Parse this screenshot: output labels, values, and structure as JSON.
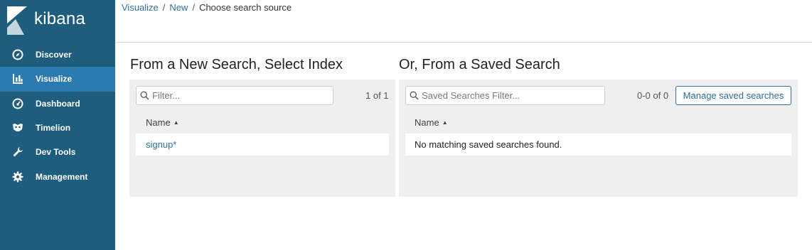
{
  "app": {
    "logo_text": "kibana"
  },
  "sidebar": {
    "items": [
      {
        "label": "Discover",
        "icon": "compass-icon"
      },
      {
        "label": "Visualize",
        "icon": "bar-chart-icon"
      },
      {
        "label": "Dashboard",
        "icon": "dashboard-gauge-icon"
      },
      {
        "label": "Timelion",
        "icon": "timelion-mask-icon"
      },
      {
        "label": "Dev Tools",
        "icon": "wrench-icon"
      },
      {
        "label": "Management",
        "icon": "gear-icon"
      }
    ],
    "active_index": 1
  },
  "breadcrumb": {
    "items": [
      "Visualize",
      "New"
    ],
    "separator": "/",
    "current": "Choose search source"
  },
  "left_panel": {
    "title": "From a New Search, Select Index",
    "filter_placeholder": "Filter...",
    "pager": "1 of 1",
    "column_header": "Name",
    "rows": [
      "signup*"
    ]
  },
  "right_panel": {
    "title": "Or, From a Saved Search",
    "filter_placeholder": "Saved Searches Filter...",
    "pager": "0-0 of 0",
    "manage_button": "Manage saved searches",
    "column_header": "Name",
    "empty_message": "No matching saved searches found."
  },
  "colors": {
    "sidebar_bg": "#1f5d7e",
    "sidebar_active": "#2c7bb0",
    "link": "#2d6f9c",
    "panel_bg": "#efefef"
  }
}
